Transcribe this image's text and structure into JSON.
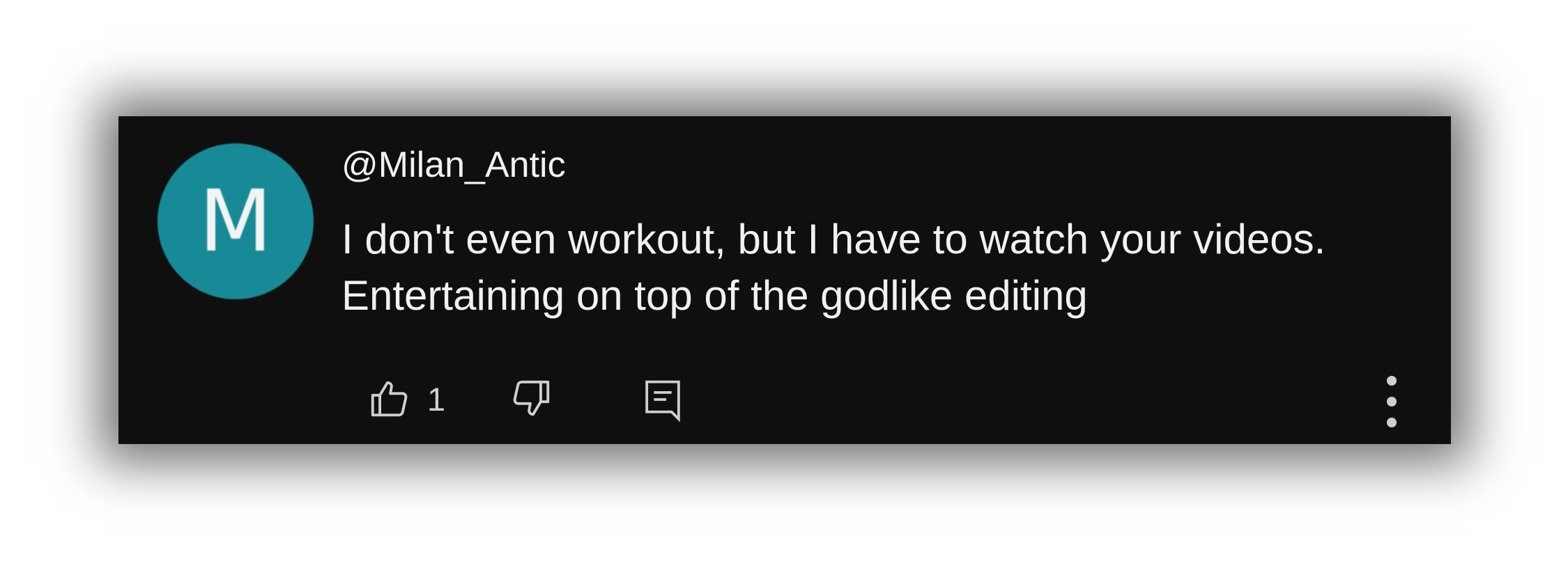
{
  "comment": {
    "author": "@Milan_Antic",
    "avatar_initial": "M",
    "avatar_color": "#178a98",
    "text_lines": [
      "I don't even workout, but I have to watch your videos.",
      "Entertaining on top of the godlike editing"
    ],
    "like_count": "1"
  },
  "icons": {
    "like": "thumbs-up-icon",
    "dislike": "thumbs-down-icon",
    "reply": "reply-comment-icon",
    "more": "more-vertical-icon"
  },
  "colors": {
    "card_background": "#0f0f0f",
    "text": "#f1f1f1",
    "icon": "#cfcfcf"
  }
}
